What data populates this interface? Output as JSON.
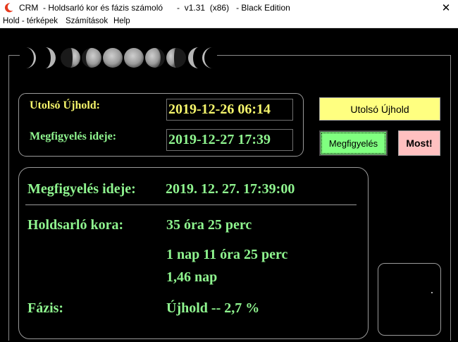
{
  "window": {
    "title": "CRM  - Holdsarló kor és fázis számoló      -  v1.31  (x86)   - Black Edition",
    "close_glyph": "✕"
  },
  "menu": {
    "items": [
      "Hold - térképek",
      "Számítások",
      "Help"
    ]
  },
  "input_panel": {
    "last_new_moon_label": "Utolsó Újhold:",
    "last_new_moon_value": "2019-12-26 06:14",
    "observation_label": "Megfigyelés ideje:",
    "observation_value": "2019-12-27 17:39"
  },
  "buttons": {
    "last_new_moon": "Utolsó Újhold",
    "observation": "Megfigyelés",
    "now": "Most!"
  },
  "results": {
    "observation_label": "Megfigyelés ideje:",
    "observation_value": "2019. 12. 27. 17:39:00",
    "age_label": "Holdsarló kora:",
    "age_hours": "35 óra 25 perc",
    "age_days_hours": "1 nap  11 óra 25 perc",
    "age_days": "1,46 nap",
    "phase_label": "Fázis:",
    "phase_value": "Újhold  --  2,7 %"
  },
  "colors": {
    "yellow_text": "#f5f56b",
    "green_text": "#8ff58f",
    "btn_yellow": "#ffff80",
    "btn_green": "#80ff80",
    "btn_pink": "#ffc0c0"
  },
  "icons": {
    "app": "crescent-moon-icon",
    "moon_phases": "moon-phases-strip"
  }
}
